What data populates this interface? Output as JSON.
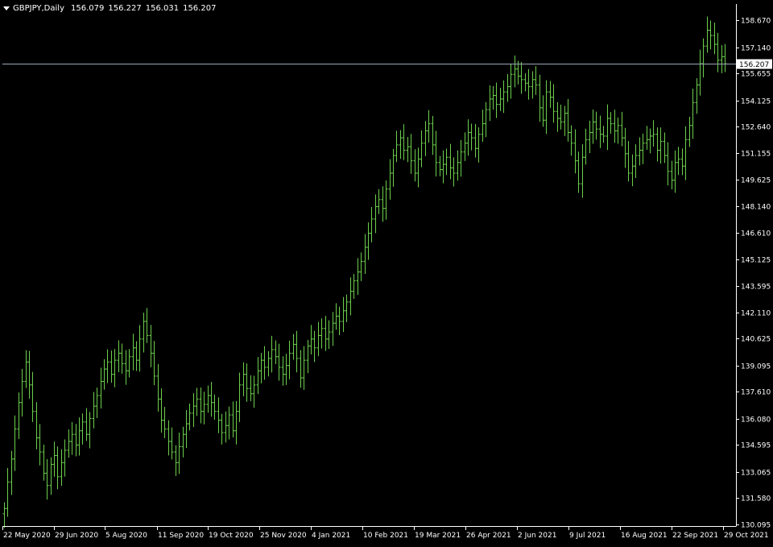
{
  "header": {
    "symbol": "GBPJPY,Daily",
    "open": "156.079",
    "high": "156.227",
    "low": "156.031",
    "close": "156.207"
  },
  "colors": {
    "background": "#000000",
    "candle": "#6ccf4c",
    "axis": "#ffffff",
    "price_line": "#9aa7b8",
    "price_tag_bg": "#ffffff",
    "price_tag_text": "#000000"
  },
  "chart_data": {
    "type": "line",
    "style": "bar-chart-ohlc",
    "grid": false,
    "ylim": [
      130.095,
      159.4
    ],
    "yticks": [
      "158.670",
      "157.140",
      "155.655",
      "154.125",
      "152.640",
      "151.155",
      "149.625",
      "148.140",
      "146.610",
      "145.125",
      "143.595",
      "142.110",
      "140.625",
      "139.095",
      "137.610",
      "136.080",
      "134.595",
      "133.065",
      "131.580",
      "130.095"
    ],
    "xticks": [
      "22 May 2020",
      "29 Jun 2020",
      "5 Aug 2020",
      "11 Sep 2020",
      "19 Oct 2020",
      "25 Nov 2020",
      "4 Jan 2021",
      "10 Feb 2021",
      "19 Mar 2021",
      "26 Apr 2021",
      "2 Jun 2021",
      "9 Jul 2021",
      "16 Aug 2021",
      "22 Sep 2021",
      "29 Oct 2021"
    ],
    "current_price": "156.207",
    "series": [
      {
        "values": [
          131.0,
          132.5,
          133.8,
          135.5,
          137.0,
          138.2,
          139.3,
          138.0,
          136.5,
          135.0,
          134.2,
          133.0,
          132.3,
          133.5,
          134.0,
          132.8,
          133.6,
          134.3,
          134.8,
          135.2,
          134.6,
          135.4,
          135.9,
          135.2,
          136.1,
          136.8,
          137.4,
          138.2,
          138.9,
          139.3,
          138.6,
          139.4,
          139.8,
          139.2,
          138.8,
          139.6,
          140.1,
          139.4,
          140.6,
          141.6,
          140.8,
          139.8,
          138.5,
          137.2,
          136.0,
          135.5,
          134.8,
          134.2,
          133.6,
          134.5,
          135.2,
          135.8,
          136.4,
          136.8,
          137.2,
          136.5,
          136.9,
          137.4,
          137.0,
          136.5,
          136.0,
          135.3,
          135.7,
          136.3,
          135.4,
          136.5,
          138.0,
          138.6,
          137.8,
          137.5,
          138.0,
          138.8,
          139.4,
          139.0,
          139.5,
          140.0,
          139.6,
          139.0,
          138.6,
          139.1,
          139.8,
          140.3,
          139.5,
          138.4,
          139.4,
          140.2,
          140.6,
          140.1,
          140.8,
          141.2,
          140.6,
          141.0,
          141.5,
          141.9,
          141.6,
          142.2,
          142.7,
          143.3,
          143.9,
          144.4,
          145.0,
          145.8,
          146.6,
          147.4,
          148.1,
          148.5,
          148.0,
          149.1,
          150.0,
          151.0,
          151.6,
          152.0,
          151.3,
          151.5,
          150.7,
          150.0,
          150.8,
          151.7,
          152.4,
          152.8,
          151.6,
          150.6,
          150.2,
          150.5,
          150.9,
          150.3,
          150.0,
          150.6,
          151.2,
          151.7,
          152.3,
          152.0,
          151.4,
          152.2,
          152.8,
          153.6,
          154.2,
          154.4,
          153.9,
          154.2,
          154.6,
          154.9,
          155.6,
          155.9,
          155.5,
          155.3,
          155.1,
          154.9,
          155.3,
          155.0,
          153.7,
          153.0,
          154.6,
          154.3,
          153.5,
          153.1,
          152.9,
          153.4,
          152.3,
          151.7,
          150.7,
          149.4,
          150.9,
          151.9,
          152.3,
          152.9,
          152.5,
          152.2,
          152.1,
          153.1,
          152.8,
          152.4,
          152.7,
          152.0,
          151.1,
          150.0,
          150.4,
          151.0,
          151.3,
          151.7,
          151.9,
          152.1,
          152.2,
          151.3,
          151.8,
          151.0,
          150.1,
          149.6,
          150.6,
          150.8,
          150.4,
          151.9,
          152.7,
          154.0,
          155.0,
          156.2,
          157.2,
          158.1,
          157.8,
          157.3,
          156.4,
          156.6,
          156.2
        ]
      }
    ]
  }
}
